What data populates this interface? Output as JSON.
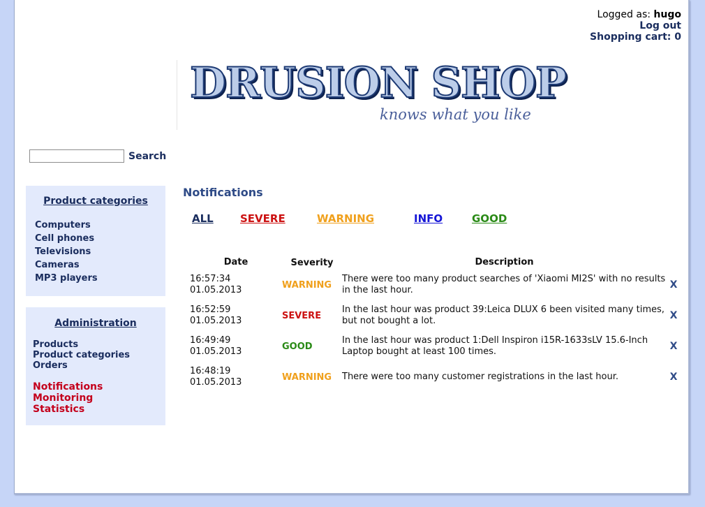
{
  "user": {
    "logged_as_label": "Logged as:",
    "username": "hugo",
    "logout": "Log out",
    "cart_label": "Shopping cart:",
    "cart_count": "0"
  },
  "logo": {
    "title": "DRUSION SHOP",
    "tagline": "knows what you like"
  },
  "search": {
    "value": "",
    "button": "Search"
  },
  "categories": {
    "title": "Product categories",
    "items": [
      "Computers",
      "Cell phones",
      "Televisions",
      "Cameras",
      "MP3 players"
    ]
  },
  "admin": {
    "title": "Administration",
    "items": [
      "Products",
      "Product categories",
      "Orders"
    ],
    "items_highlight": [
      "Notifications",
      "Monitoring",
      "Statistics"
    ]
  },
  "notifications": {
    "title": "Notifications",
    "filters": [
      {
        "label": "ALL",
        "color": "#1a2d5e"
      },
      {
        "label": "SEVERE",
        "color": "#cc1111"
      },
      {
        "label": "WARNING",
        "color": "#f0a01c"
      },
      {
        "label": "INFO",
        "color": "#1414d6"
      },
      {
        "label": "GOOD",
        "color": "#2a8a16"
      }
    ],
    "columns": [
      "Date",
      "Severity",
      "Description"
    ],
    "rows": [
      {
        "time": "16:57:34",
        "date": "01.05.2013",
        "severity": "WARNING",
        "description": "There were too many product searches of 'Xiaomi MI2S' with no results in the last hour.",
        "remove": "X"
      },
      {
        "time": "16:52:59",
        "date": "01.05.2013",
        "severity": "SEVERE",
        "description": "In the last hour was product 39:Leica DLUX 6 been visited many times, but not bought a lot.",
        "remove": "X"
      },
      {
        "time": "16:49:49",
        "date": "01.05.2013",
        "severity": "GOOD",
        "description": "In the last hour was product 1:Dell Inspiron i15R-1633sLV 15.6-Inch Laptop bought at least 100 times.",
        "remove": "X"
      },
      {
        "time": "16:48:19",
        "date": "01.05.2013",
        "severity": "WARNING",
        "description": "There were too many customer registrations in the last hour.",
        "remove": "X"
      }
    ]
  }
}
